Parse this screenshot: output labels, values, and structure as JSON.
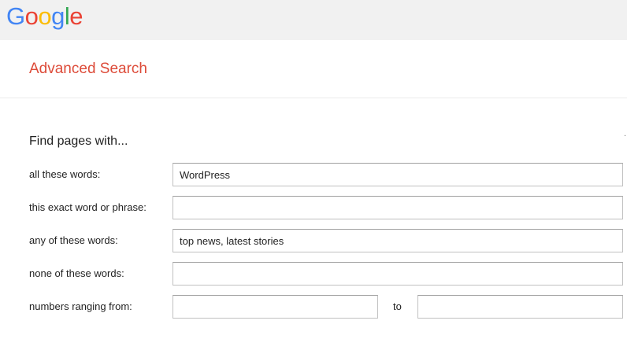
{
  "logo": {
    "letters": [
      "G",
      "o",
      "o",
      "g",
      "l",
      "e"
    ],
    "colors": [
      "#4285f4",
      "#ea4335",
      "#fbbc05",
      "#4285f4",
      "#34a853",
      "#ea4335"
    ]
  },
  "page": {
    "title": "Advanced Search",
    "title_color": "#dd4b39"
  },
  "section": {
    "title": "Find pages with...",
    "corner_mark": "."
  },
  "fields": {
    "all_words": {
      "label": "all these words:",
      "value": "WordPress"
    },
    "exact_phrase": {
      "label": "this exact word or phrase:",
      "value": ""
    },
    "any_words": {
      "label": "any of these words:",
      "value": "top news, latest stories"
    },
    "none_words": {
      "label": "none of these words:",
      "value": ""
    },
    "numbers": {
      "label": "numbers ranging from:",
      "from_value": "",
      "to_label": "to",
      "to_value": ""
    }
  }
}
